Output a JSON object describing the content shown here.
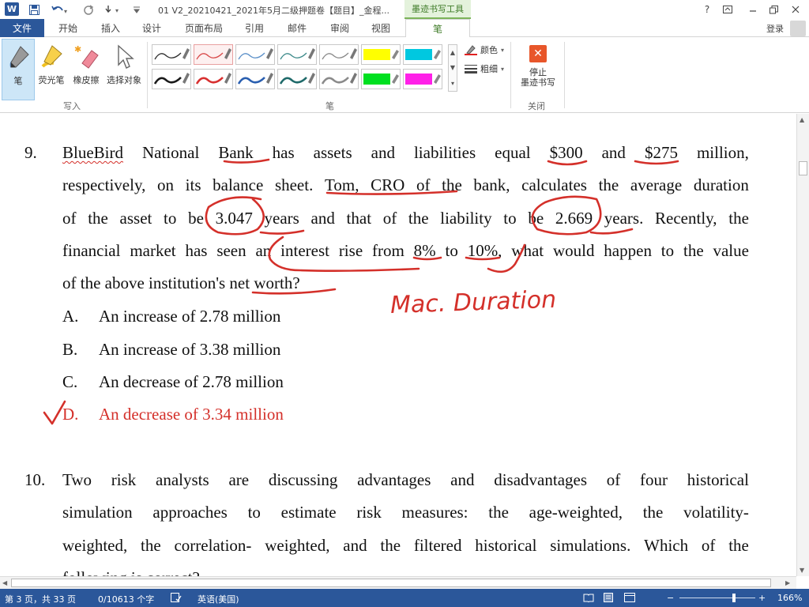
{
  "window": {
    "app_icon": "W",
    "quick_access": [
      "save-icon",
      "undo-icon",
      "redo-icon",
      "touch-mode-icon",
      "customize-icon"
    ],
    "title": "01 V2_20210421_2021年5月二级押题卷【题目】_金程...",
    "context_tab": "墨迹书写工具",
    "help": "?",
    "controls": [
      "ribbon-display-icon",
      "minimize-icon",
      "restore-icon",
      "close-icon"
    ]
  },
  "tabs": {
    "file": "文件",
    "items": [
      "开始",
      "插入",
      "设计",
      "页面布局",
      "引用",
      "邮件",
      "审阅",
      "视图"
    ],
    "active": "笔",
    "signin": "登录"
  },
  "ribbon": {
    "write_tools": [
      "笔",
      "荧光笔",
      "橡皮擦",
      "选择对象"
    ],
    "write_group": "写入",
    "pens_group": "笔",
    "color_label": "颜色",
    "thickness_label": "粗细",
    "stop_label_1": "停止",
    "stop_label_2": "墨迹书写",
    "close_group": "关闭",
    "pen_colors": [
      "#2d2d2d",
      "#d84a4a",
      "#5a8fc8",
      "#3d8a8a",
      "#8a8a8a",
      "#ffff00",
      "#00c8e0",
      "#1a1a1a",
      "#d83030",
      "#2a5fb0",
      "#1f6a6a",
      "#8a8a8a",
      "#00e020",
      "#ff20e8"
    ]
  },
  "doc": {
    "q9": {
      "number": "9.",
      "l1_words": [
        "BlueBird",
        "National",
        "Bank",
        "has",
        "assets",
        "and",
        "liabilities",
        "equal",
        "$300",
        "and",
        "$275",
        "million,"
      ],
      "l2_words": [
        "respectively,",
        "on",
        "its",
        "balance",
        "sheet.",
        "Tom,",
        "CRO",
        "of",
        "the",
        "bank,",
        "calculates",
        "the",
        "average",
        "duration"
      ],
      "l3_words": [
        "of",
        "the",
        "asset",
        "to",
        "be",
        "3.047",
        "years",
        "and",
        "that",
        "of",
        "the",
        "liability",
        "to",
        "be",
        "2.669",
        "years.",
        "Recently,",
        "the"
      ],
      "l4_words": [
        "financial",
        "market",
        "has",
        "seen",
        "an",
        "interest",
        "rise",
        "from",
        "8%",
        "to",
        "10%,",
        "what",
        "would",
        "happen",
        "to",
        "the",
        "value"
      ],
      "l5": "of the above institution's net worth?",
      "options": [
        {
          "letter": "A.",
          "text": "An increase of 2.78 million"
        },
        {
          "letter": "B.",
          "text": "An increase of 3.38 million"
        },
        {
          "letter": "C.",
          "text": "An decrease of 2.78 million"
        },
        {
          "letter": "D.",
          "text": "An decrease of 3.34 million"
        }
      ],
      "handwritten_note": "Mac. Duration"
    },
    "q10": {
      "number": "10.",
      "l1_words": [
        "Two",
        "risk",
        "analysts",
        "are",
        "discussing",
        "advantages",
        "and",
        "disadvantages",
        "of",
        "four",
        "historical"
      ],
      "l2_words": [
        "simulation",
        "approaches",
        "to",
        "estimate",
        "risk",
        "measures:",
        "the",
        "age-weighted,",
        "the",
        "volatility-"
      ],
      "l3_words": [
        "weighted,",
        "the",
        "correlation-",
        "weighted,",
        "and",
        "the",
        "filtered",
        "historical",
        "simulations.",
        "Which",
        "of",
        "the"
      ],
      "l4": "following is correct?"
    }
  },
  "status": {
    "page": "第 3 页，共 33 页",
    "words": "0/10613 个字",
    "language": "英语(美国)",
    "zoom": "166%",
    "zoom_fraction": 0.72
  }
}
